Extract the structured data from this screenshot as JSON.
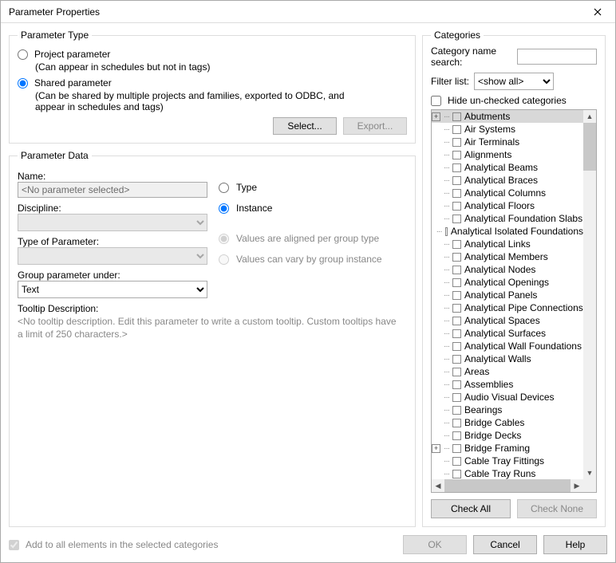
{
  "title": "Parameter Properties",
  "paramType": {
    "legend": "Parameter Type",
    "project": {
      "label": "Project parameter",
      "desc": "(Can appear in schedules but not in tags)",
      "selected": false
    },
    "shared": {
      "label": "Shared parameter",
      "desc": "(Can be shared by multiple projects and families, exported to ODBC, and appear in schedules and tags)",
      "selected": true
    },
    "selectBtn": "Select...",
    "exportBtn": "Export..."
  },
  "paramData": {
    "legend": "Parameter Data",
    "nameLabel": "Name:",
    "nameValue": "<No parameter selected>",
    "disciplineLabel": "Discipline:",
    "typeParamLabel": "Type of Parameter:",
    "groupLabel": "Group parameter under:",
    "groupValue": "Text",
    "tooltipLabel": "Tooltip Description:",
    "tooltipText": "<No tooltip description. Edit this parameter to write a custom tooltip. Custom tooltips have a limit of 250 characters.>",
    "typeRadio": "Type",
    "instanceRadio": "Instance",
    "alignedRadio": "Values are aligned per group type",
    "varyRadio": "Values can vary by group instance"
  },
  "categories": {
    "legend": "Categories",
    "searchLabel": "Category name search:",
    "filterLabel": "Filter list:",
    "filterValue": "<show all>",
    "hideLabel": "Hide un-checked categories",
    "checkAll": "Check All",
    "checkNone": "Check None",
    "items": [
      {
        "label": "Abutments",
        "plus": true,
        "selected": true
      },
      {
        "label": "Air Systems"
      },
      {
        "label": "Air Terminals"
      },
      {
        "label": "Alignments"
      },
      {
        "label": "Analytical Beams"
      },
      {
        "label": "Analytical Braces"
      },
      {
        "label": "Analytical Columns"
      },
      {
        "label": "Analytical Floors"
      },
      {
        "label": "Analytical Foundation Slabs"
      },
      {
        "label": "Analytical Isolated Foundations"
      },
      {
        "label": "Analytical Links"
      },
      {
        "label": "Analytical Members"
      },
      {
        "label": "Analytical Nodes"
      },
      {
        "label": "Analytical Openings"
      },
      {
        "label": "Analytical Panels"
      },
      {
        "label": "Analytical Pipe Connections"
      },
      {
        "label": "Analytical Spaces"
      },
      {
        "label": "Analytical Surfaces"
      },
      {
        "label": "Analytical Wall Foundations"
      },
      {
        "label": "Analytical Walls"
      },
      {
        "label": "Areas"
      },
      {
        "label": "Assemblies"
      },
      {
        "label": "Audio Visual Devices"
      },
      {
        "label": "Bearings"
      },
      {
        "label": "Bridge Cables"
      },
      {
        "label": "Bridge Decks"
      },
      {
        "label": "Bridge Framing",
        "plus": true
      },
      {
        "label": "Cable Tray Fittings"
      },
      {
        "label": "Cable Tray Runs"
      }
    ]
  },
  "footer": {
    "addAll": "Add to all elements in the selected categories",
    "ok": "OK",
    "cancel": "Cancel",
    "help": "Help"
  }
}
